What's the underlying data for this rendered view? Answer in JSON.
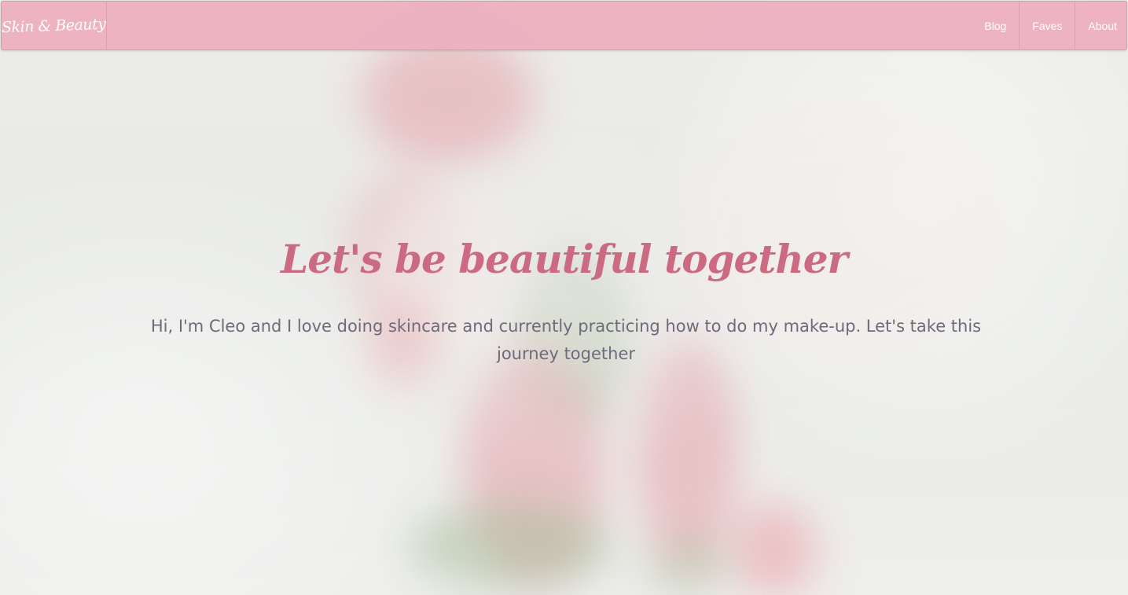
{
  "navbar": {
    "brand": "Skin & Beauty",
    "links": [
      {
        "label": "Blog"
      },
      {
        "label": "Faves"
      },
      {
        "label": "About"
      }
    ]
  },
  "hero": {
    "title": "Let's be beautiful together",
    "text": "Hi, I'm Cleo and I love doing skincare and currently practicing how to do my make-up. Let's take this journey together"
  },
  "colors": {
    "navbar_background": "#ecb4c0",
    "title": "#cc6a82",
    "body_text": "#6f6a7a",
    "flower_pink": "#e5a1a8",
    "leaf_green": "#a4bc98"
  }
}
